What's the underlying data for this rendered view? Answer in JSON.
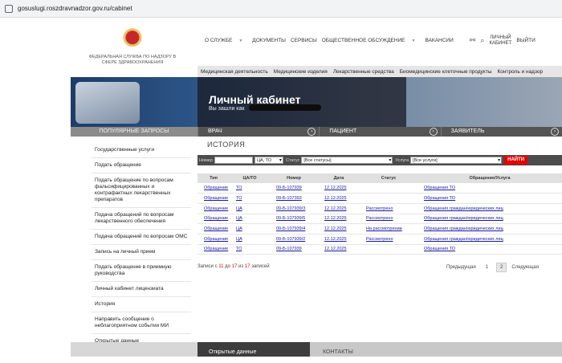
{
  "browser": {
    "url": "gosuslugi.roszdravnadzor.gov.ru/cabinet"
  },
  "logo": {
    "text": "ФЕДЕРАЛЬНАЯ СЛУЖБА ПО НАДЗОРУ В СФЕРЕ ЗДРАВООХРАНЕНИЯ"
  },
  "topnav": {
    "items": [
      "О СЛУЖБЕ",
      "ДОКУМЕНТЫ",
      "СЕРВИСЫ",
      "ОБЩЕСТВЕННОЕ ОБСУЖДЕНИЕ",
      "ВАКАНСИИ"
    ],
    "cabinet": "ЛИЧНЫЙ КАБИНЕТ",
    "logout": "ВЫЙТИ"
  },
  "categories": [
    "Медицинская деятельность",
    "Медицинские изделия",
    "Лекарственные средства",
    "Биомедицинские клеточные продукты",
    "Контроль и надзор"
  ],
  "banner": {
    "title": "Личный кабинет",
    "subtitle": "Вы зашли как"
  },
  "menubar": {
    "popular": "ПОПУЛЯРНЫЕ ЗАПРОСЫ",
    "items": [
      "ВРАЧ",
      "ПАЦИЕНТ",
      "ЗАЯВИТЕЛЬ"
    ]
  },
  "sidebar": {
    "items": [
      "Государственные услуги",
      "Подать обращение",
      "Подать обращение по вопросам фальсифицированных и контрафактных лекарственных препаратов",
      "Подача обращений по вопросам лекарственного обеспечения",
      "Подача обращений по вопросам ОМС",
      "Запись на личный прием",
      "Подать обращение в приемную руководства",
      "Личный кабинет лицензиата",
      "История",
      "Направить сообщение о неблагоприятном событии МИ",
      "Открытые данные"
    ]
  },
  "history": {
    "title": "ИСТОРИЯ"
  },
  "filter": {
    "number_label": "Номер",
    "type_value": "ЦА, ТО",
    "status_label": "Статус",
    "status_value": "[Все статусы]",
    "service_label": "Услуга",
    "service_value": "[Все услуги]",
    "find_label": "НАЙТИ"
  },
  "table": {
    "headers": [
      "Тип",
      "ЦА/ТО",
      "Номер",
      "Дата",
      "Статус",
      "Обращение/Услуга"
    ],
    "rows": [
      [
        "Обращение",
        "ТО",
        "09-Б-107939",
        "12.12.2025",
        "",
        "Обращения ТО"
      ],
      [
        "Обращение",
        "ТО",
        "09-Б-107393",
        "12.12.2025",
        "",
        "Обращения ТО"
      ],
      [
        "Обращение",
        "ЦА",
        "09-Б-107939/3",
        "12.12.2025",
        "Рассмотрено",
        "Обращения граждан/юридических лиц"
      ],
      [
        "Обращение",
        "ЦА",
        "09-Б-107939/5",
        "12.12.2025",
        "Рассмотрено",
        "Обращения граждан/юридических лиц"
      ],
      [
        "Обращение",
        "ЦА",
        "09-Б-107939/4",
        "12.12.2025",
        "На рассмотрении",
        "Обращения граждан/юридических лиц"
      ],
      [
        "Обращение",
        "ЦА",
        "09-Б-107939/2",
        "12.12.2025",
        "Рассмотрено",
        "Обращения граждан/юридических лиц"
      ],
      [
        "Обращение",
        "ТО",
        "09-Б-107939",
        "12.12.2025",
        "",
        "Обращения ТО"
      ]
    ]
  },
  "records": {
    "prefix": "Записи с",
    "from": "11",
    "to_word": "до",
    "to": "17",
    "of_word": "из",
    "total": "17",
    "suffix": "записей"
  },
  "pager": {
    "prev": "Предыдущая",
    "page1": "1",
    "page2": "2",
    "next": "Следующая"
  },
  "footer": {
    "open_data": "Открытые данные",
    "contacts": "КОНТАКТЫ"
  }
}
